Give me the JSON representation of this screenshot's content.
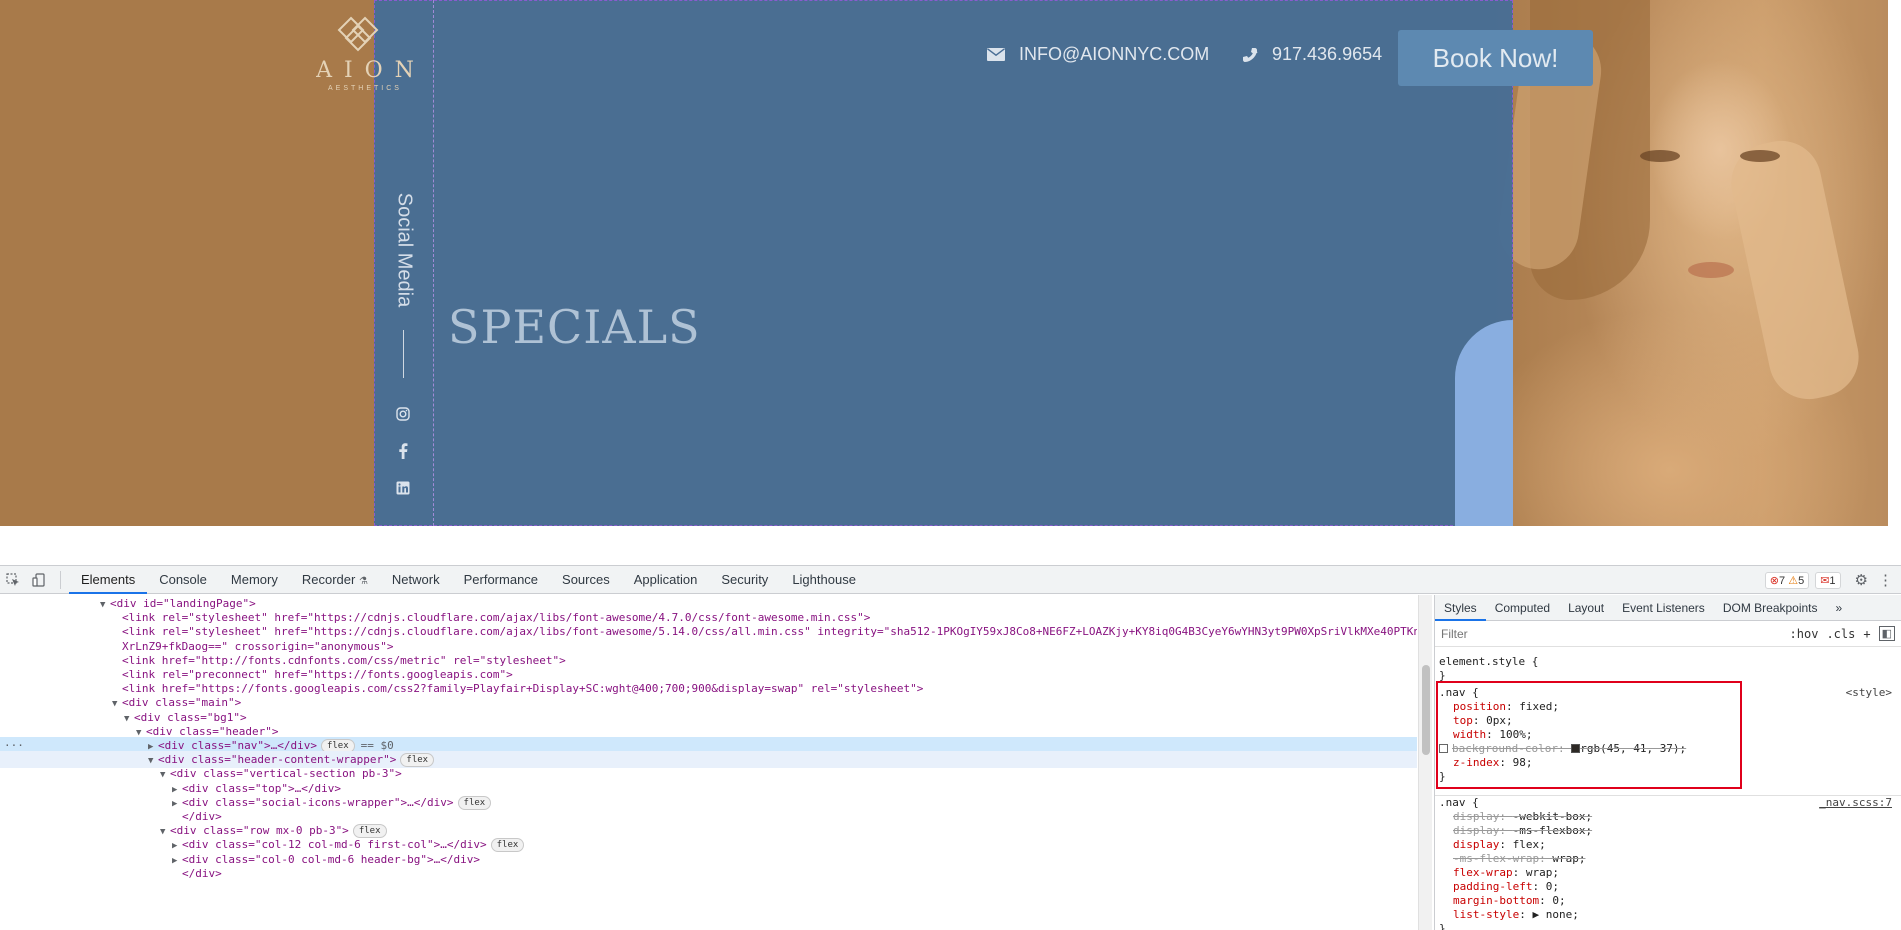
{
  "hero": {
    "logo_name": "AION",
    "logo_sub": "AESTHETICS",
    "email": "INFO@AIONNYC.COM",
    "phone": "917.436.9654",
    "book_label": "Book Now!",
    "title": "SPECIALS",
    "social_label": "Social Media",
    "social_icons": [
      "instagram-icon",
      "facebook-icon",
      "linkedin-icon"
    ]
  },
  "devtools": {
    "tabs": [
      "Elements",
      "Console",
      "Memory",
      "Recorder",
      "Network",
      "Performance",
      "Sources",
      "Application",
      "Security",
      "Lighthouse"
    ],
    "active_tab": "Elements",
    "errors": "7",
    "warnings": "5",
    "issues": "1",
    "dom_lines": [
      {
        "indent": 7,
        "arrow": "▼",
        "html": "<div id=\"landingPage\">"
      },
      {
        "indent": 8,
        "arrow": "",
        "html": "<link rel=\"stylesheet\" href=\"https://cdnjs.cloudflare.com/ajax/libs/font-awesome/4.7.0/css/font-awesome.min.css\">"
      },
      {
        "indent": 8,
        "arrow": "",
        "html": "<link rel=\"stylesheet\" href=\"https://cdnjs.cloudflare.com/ajax/libs/font-awesome/5.14.0/css/all.min.css\" integrity=\"sha512-1PKOgIY59xJ8Co8+NE6FZ+LOAZKjy+KY8iq0G4B3CyeY6wYHN3yt9PW0XpSriVlkMXe40PTKn"
      },
      {
        "indent": 8,
        "arrow": "",
        "html": "XrLnZ9+fkDaog==\" crossorigin=\"anonymous\">"
      },
      {
        "indent": 8,
        "arrow": "",
        "html": "<link href=\"http://fonts.cdnfonts.com/css/metric\" rel=\"stylesheet\">"
      },
      {
        "indent": 8,
        "arrow": "",
        "html": "<link rel=\"preconnect\" href=\"https://fonts.googleapis.com\">"
      },
      {
        "indent": 8,
        "arrow": "",
        "html": "<link href=\"https://fonts.googleapis.com/css2?family=Playfair+Display+SC:wght@400;700;900&display=swap\" rel=\"stylesheet\">"
      },
      {
        "indent": 8,
        "arrow": "▼",
        "html": "<div class=\"main\">"
      },
      {
        "indent": 9,
        "arrow": "▼",
        "html": "<div class=\"bg1\">"
      },
      {
        "indent": 10,
        "arrow": "▼",
        "html": "<div class=\"header\">"
      },
      {
        "indent": 11,
        "arrow": "▶",
        "html": "<div class=\"nav\">…</div>",
        "pill": "flex",
        "suffix": "== $0"
      },
      {
        "indent": 11,
        "arrow": "▼",
        "html": "<div class=\"header-content-wrapper\">",
        "pill": "flex"
      },
      {
        "indent": 12,
        "arrow": "▼",
        "html": "<div class=\"vertical-section pb-3\">"
      },
      {
        "indent": 13,
        "arrow": "▶",
        "html": "<div class=\"top\">…</div>"
      },
      {
        "indent": 13,
        "arrow": "▶",
        "html": "<div class=\"social-icons-wrapper\">…</div>",
        "pill": "flex"
      },
      {
        "indent": 13,
        "arrow": "",
        "html": "</div>"
      },
      {
        "indent": 12,
        "arrow": "▼",
        "html": "<div class=\"row mx-0 pb-3\">",
        "pill": "flex"
      },
      {
        "indent": 13,
        "arrow": "▶",
        "html": "<div class=\"col-12 col-md-6 first-col\">…</div>",
        "pill": "flex"
      },
      {
        "indent": 13,
        "arrow": "▶",
        "html": "<div class=\"col-0 col-md-6 header-bg\">…</div>"
      },
      {
        "indent": 13,
        "arrow": "",
        "html": "</div>"
      }
    ],
    "styles_tabs": [
      "Styles",
      "Computed",
      "Layout",
      "Event Listeners",
      "DOM Breakpoints",
      "»"
    ],
    "filter_placeholder": "Filter",
    "filter_buttons": [
      ":hov",
      ".cls",
      "+"
    ],
    "element_style": "element.style {",
    "rule1": {
      "selector": ".nav {",
      "source": "<style>",
      "decls": [
        {
          "p": "position",
          "v": "fixed;"
        },
        {
          "p": "top",
          "v": "0px;"
        },
        {
          "p": "width",
          "v": "100%;"
        },
        {
          "p": "background-color",
          "v": "rgb(45, 41, 37);",
          "struck": true,
          "checkbox": true,
          "swatch": "#2d2925"
        },
        {
          "p": "z-index",
          "v": "98;"
        }
      ]
    },
    "rule2": {
      "selector": ".nav {",
      "source": "_nav.scss:7",
      "decls": [
        {
          "p": "display",
          "v": "-webkit-box;",
          "struck": true
        },
        {
          "p": "display",
          "v": "-ms-flexbox;",
          "struck": true
        },
        {
          "p": "display",
          "v": "flex;"
        },
        {
          "p": "-ms-flex-wrap",
          "v": "wrap;",
          "struck": true
        },
        {
          "p": "flex-wrap",
          "v": "wrap;"
        },
        {
          "p": "padding-left",
          "v": "0;"
        },
        {
          "p": "margin-bottom",
          "v": "0;"
        },
        {
          "p": "list-style",
          "v": "▶ none;"
        }
      ]
    }
  }
}
